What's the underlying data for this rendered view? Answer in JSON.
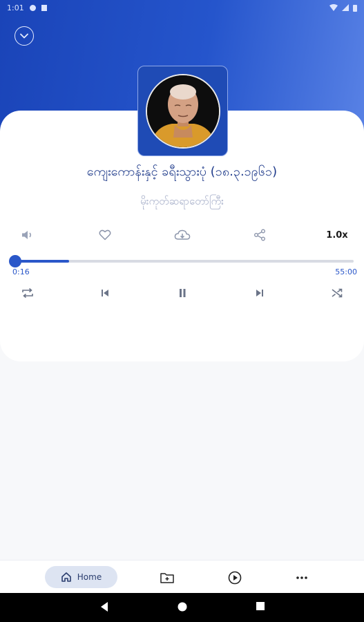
{
  "status_bar": {
    "time": "1:01"
  },
  "track": {
    "title": "ကျေးကောန်းနှင့် ခရီးသွားပုံ (၁၈.၃.၁၉၆၁)",
    "artist": "မိုးကုတ်ဆရာတော်ကြီး"
  },
  "actions": {
    "volume_icon": "volume-icon",
    "favorite_icon": "heart-icon",
    "download_icon": "cloud-download-icon",
    "share_icon": "share-icon",
    "speed_label": "1.0x"
  },
  "player": {
    "current_time": "0:16",
    "total_time": "55:00",
    "progress_fraction": 0.16
  },
  "controls": [
    "repeat-icon",
    "previous-icon",
    "pause-icon",
    "next-icon",
    "shuffle-icon"
  ],
  "bottom_nav": {
    "home_label": "Home",
    "items": [
      "home-icon",
      "folder-add-icon",
      "play-circle-icon",
      "more-icon"
    ]
  },
  "colors": {
    "accent": "#2a57c9",
    "header_gradient_start": "#1a44b8",
    "header_gradient_end": "#5a83e6",
    "title": "#1e3a8a",
    "subtitle": "#a4adc8"
  }
}
